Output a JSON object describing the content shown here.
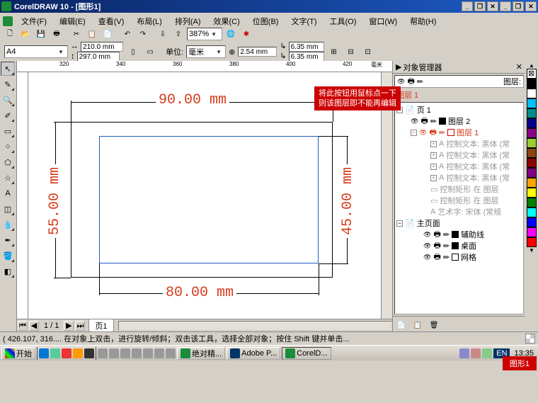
{
  "title": "CorelDRAW 10 - [图形1]",
  "menu": {
    "file": "文件(F)",
    "edit": "编辑(E)",
    "view": "查看(V)",
    "layout": "布局(L)",
    "arrange": "排列(A)",
    "effects": "效果(C)",
    "bitmaps": "位图(B)",
    "text": "文字(T)",
    "tools": "工具(O)",
    "window": "窗口(W)",
    "help": "帮助(H)"
  },
  "zoom": "387%",
  "page_size": "A4",
  "dims": {
    "w": "210.0 mm",
    "h": "297.0 mm"
  },
  "units_label": "单位:",
  "units": "毫米",
  "nudge": "2.54 mm",
  "dup": {
    "x": "6.35 mm",
    "y": "6.35 mm"
  },
  "ruler_h": [
    "320",
    "340",
    "360",
    "380",
    "400",
    "420",
    "毫米"
  ],
  "drawing": {
    "top_dim": "90.00 mm",
    "left_dim": "55.00 mm",
    "right_dim": "45.00 mm",
    "bottom_dim": "80.00 mm"
  },
  "pager": {
    "pages": "1 / 1",
    "tab": "页1"
  },
  "docker": {
    "title": "对象管理器",
    "header_right": "图层:",
    "header_layer": "图层 1",
    "page": "页 1",
    "layer2": "图层 2",
    "layer1": "图层 1",
    "ctrl_text": "控制文本: 黑体 (常",
    "ctrl_rect": "控制矩形 在 图层",
    "art_text": "艺术字: 宋体 (常规",
    "master": "主页面",
    "guides": "辅助线",
    "desktop": "桌面",
    "grid": "网格"
  },
  "tooltip": {
    "line1": "将此按钮用鼠标点一下",
    "line2": "则该图层即不能再编辑"
  },
  "status": "( 426.107, 316....    在对象上双击，进行旋转/倾斜；双击该工具，选择全部对象；按住 Shift 键并单击...",
  "status_right": "图形1",
  "taskbar": {
    "start": "开始",
    "tasks": [
      "绝对精...",
      "Adobe P...",
      "CorelD..."
    ],
    "ime": "EN",
    "time": "13:35"
  },
  "colors": [
    "#000000",
    "#ffffff",
    "#00bfff",
    "#008b8b",
    "#00008b",
    "#8b008b",
    "#9acd32",
    "#8b4513",
    "#8b0000",
    "#800080",
    "#ffa500",
    "#ffff00",
    "#008000",
    "#00ffff",
    "#0000ff",
    "#ff00ff",
    "#ff0000"
  ]
}
